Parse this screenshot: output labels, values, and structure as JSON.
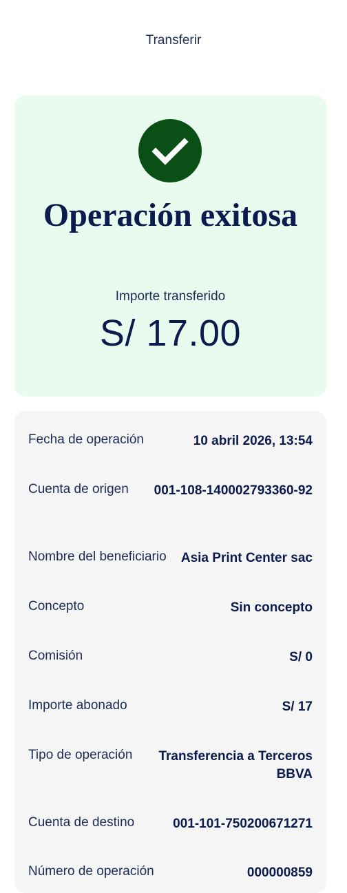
{
  "header": {
    "title": "Transferir"
  },
  "success": {
    "title": "Operación exitosa",
    "amount_label": "Importe transferido",
    "amount_value": "S/ 17.00",
    "icon": "check-circle-icon",
    "icon_color": "#0a4f16",
    "card_color": "#e8fbee"
  },
  "details": {
    "rows": [
      {
        "label": "Fecha de operación",
        "value": "10 abril 2026, 13:54"
      },
      {
        "label": "Cuenta de origen",
        "value": "001-108-140002793360-92"
      },
      {
        "label": "Nombre del beneficiario",
        "value": "Asia Print Center sac"
      },
      {
        "label": "Concepto",
        "value": "Sin concepto"
      },
      {
        "label": "Comisión",
        "value": "S/ 0"
      },
      {
        "label": "Importe abonado",
        "value": "S/ 17"
      },
      {
        "label": "Tipo de operación",
        "value": "Transferencia a Terceros BBVA"
      },
      {
        "label": "Cuenta de destino",
        "value": "001-101-750200671271"
      },
      {
        "label": "Número de operación",
        "value": "000000859"
      }
    ]
  }
}
